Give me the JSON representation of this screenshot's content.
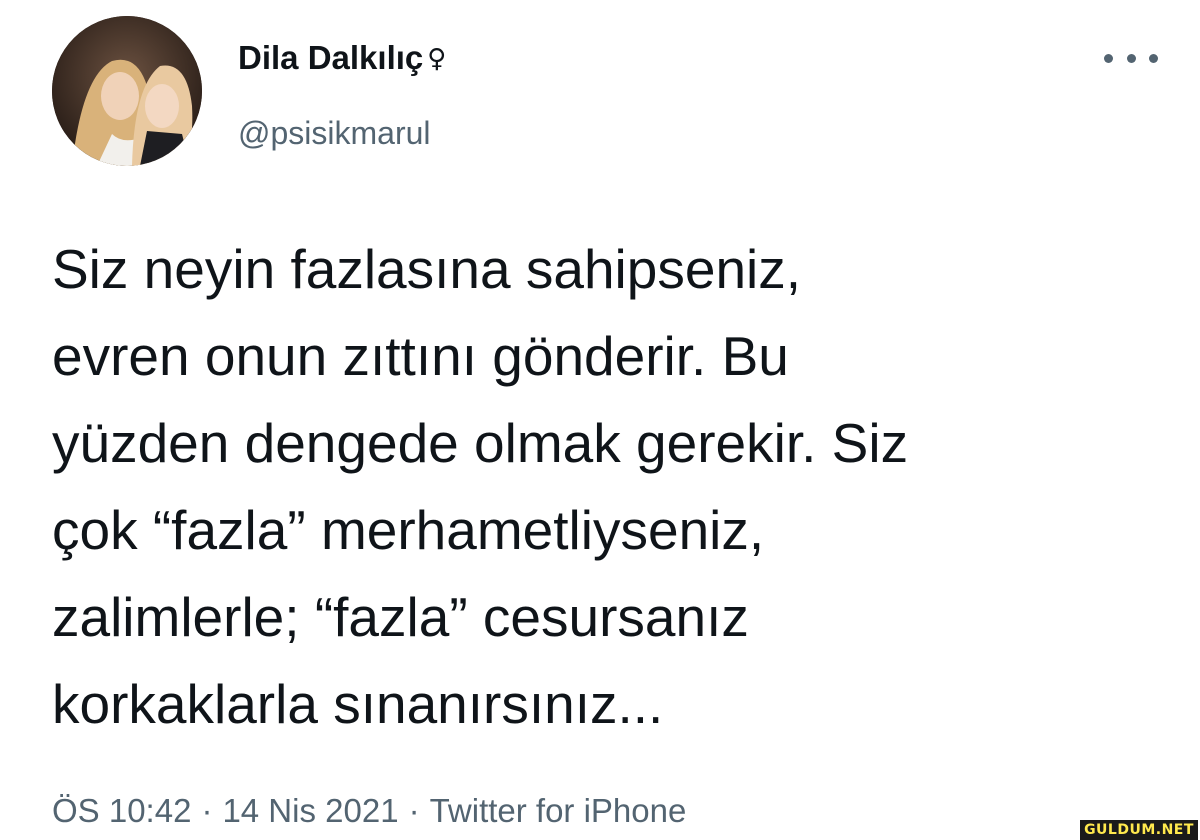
{
  "author": {
    "display_name": "Dila Dalkılıç",
    "name_emoji": "♀",
    "handle": "@psisikmarul",
    "avatar_icon": "profile-photo-avatar-icon"
  },
  "more_menu": {
    "icon": "more-horizontal-icon"
  },
  "tweet": {
    "lines": [
      "Siz neyin fazlasına sahipseniz,",
      "evren onun zıttını gönderir. Bu",
      "yüzden dengede olmak gerekir. Siz",
      "çok “fazla” merhametliyseniz,",
      "zalimlerle; “fazla” cesursanız",
      "korkaklarla sınanırsınız..."
    ]
  },
  "meta": {
    "time": "ÖS 10:42",
    "separator": "·",
    "date": "14 Nis 2021",
    "source": "Twitter for iPhone"
  },
  "watermark": {
    "text": "GULDUM.NET"
  },
  "colors": {
    "text": "#0f1419",
    "secondary": "#536471",
    "background": "#ffffff"
  }
}
